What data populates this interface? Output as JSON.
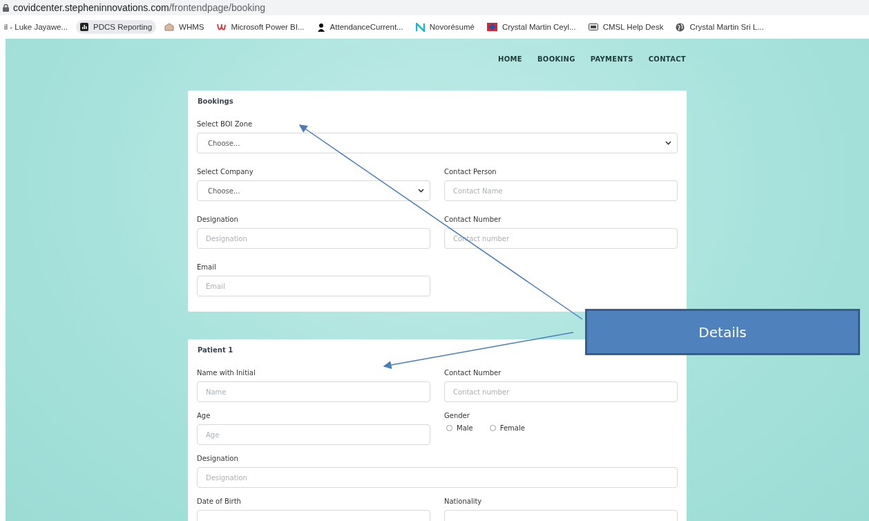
{
  "address_bar": {
    "host": "covidcenter.stepheninnovations.com",
    "path": "/frontendpage/booking"
  },
  "bookmarks": [
    {
      "label": "il - Luke Jayawe...",
      "kind": "none",
      "selected": false
    },
    {
      "label": "PDCS Reporting",
      "kind": "chart",
      "selected": true
    },
    {
      "label": "WHMS",
      "kind": "house",
      "selected": false
    },
    {
      "label": "Microsoft Power BI...",
      "kind": "letter",
      "selected": false
    },
    {
      "label": "AttendanceCurrent...",
      "kind": "person",
      "selected": false
    },
    {
      "label": "Novorésumé",
      "kind": "n",
      "selected": false
    },
    {
      "label": "Crystal Martin Ceyl...",
      "kind": "diamond",
      "selected": false
    },
    {
      "label": "CMSL Help Desk",
      "kind": "card",
      "selected": false
    },
    {
      "label": "Crystal Martin Sri L...",
      "kind": "globe",
      "selected": false
    }
  ],
  "nav": [
    {
      "label": "HOME"
    },
    {
      "label": "BOOKING"
    },
    {
      "label": "PAYMENTS"
    },
    {
      "label": "CONTACT"
    }
  ],
  "sections": [
    {
      "title": "Bookings",
      "fields": [
        {
          "kind": "select",
          "label": "Select BOI Zone",
          "value": "Choose...",
          "wide": true
        },
        {
          "kind": "select",
          "label": "Select Company",
          "value": "Choose...",
          "wide": false
        },
        {
          "kind": "input",
          "label": "Contact Person",
          "placeholder": "Contact Name",
          "wide": false
        },
        {
          "kind": "input",
          "label": "Designation",
          "placeholder": "Designation",
          "wide": false
        },
        {
          "kind": "input",
          "label": "Contact Number",
          "placeholder": "Contact number",
          "wide": false
        },
        {
          "kind": "input",
          "label": "Email",
          "placeholder": "Email",
          "wide": false
        }
      ]
    },
    {
      "title": "Patient 1",
      "fields": [
        {
          "kind": "input",
          "label": "Name with Initial",
          "placeholder": "Name",
          "wide": false
        },
        {
          "kind": "input",
          "label": "Contact Number",
          "placeholder": "Contact number",
          "wide": false
        },
        {
          "kind": "input",
          "label": "Age",
          "placeholder": "Age",
          "wide": false
        },
        {
          "kind": "radio",
          "label": "Gender",
          "options": [
            {
              "label": "Male",
              "selected": false
            },
            {
              "label": "Female",
              "selected": false
            }
          ],
          "wide": false
        },
        {
          "kind": "input",
          "label": "Designation",
          "placeholder": "Designation",
          "wide": true
        },
        {
          "kind": "input",
          "label": "Date of Birth",
          "wide": false
        },
        {
          "kind": "input",
          "label": "Nationality",
          "wide": false
        }
      ]
    }
  ],
  "callout": {
    "text": "Details"
  }
}
